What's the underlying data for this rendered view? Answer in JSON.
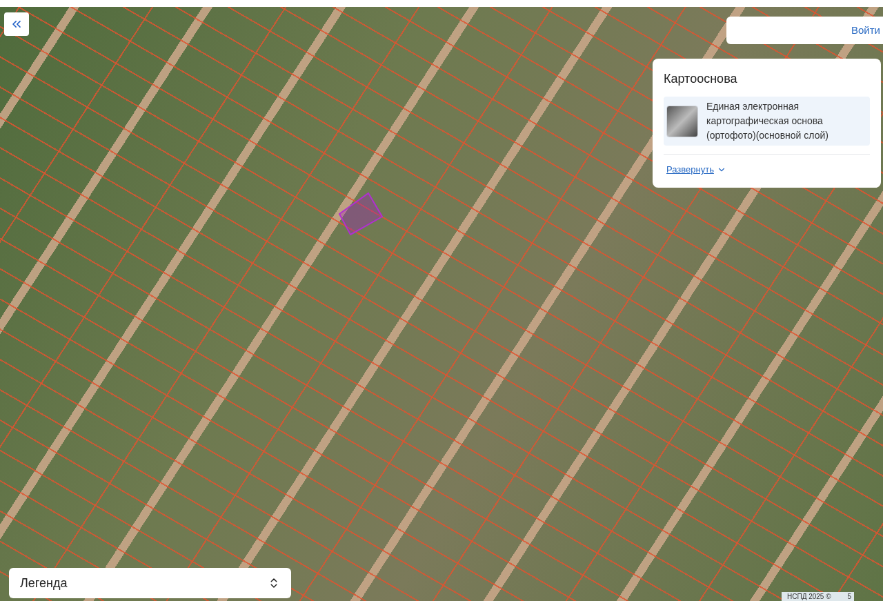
{
  "login_button": {
    "label": "Войти"
  },
  "basemap_panel": {
    "title": "Картооснова",
    "layer": {
      "name": "Единая электронная картографическая основа (ортофото)(основной слой)",
      "selected": true
    },
    "expand_link": "Развернуть"
  },
  "legend": {
    "label": "Легенда",
    "expanded": false
  },
  "attribution": {
    "text": "НСПД 2025 ©",
    "scale_label": "5"
  }
}
